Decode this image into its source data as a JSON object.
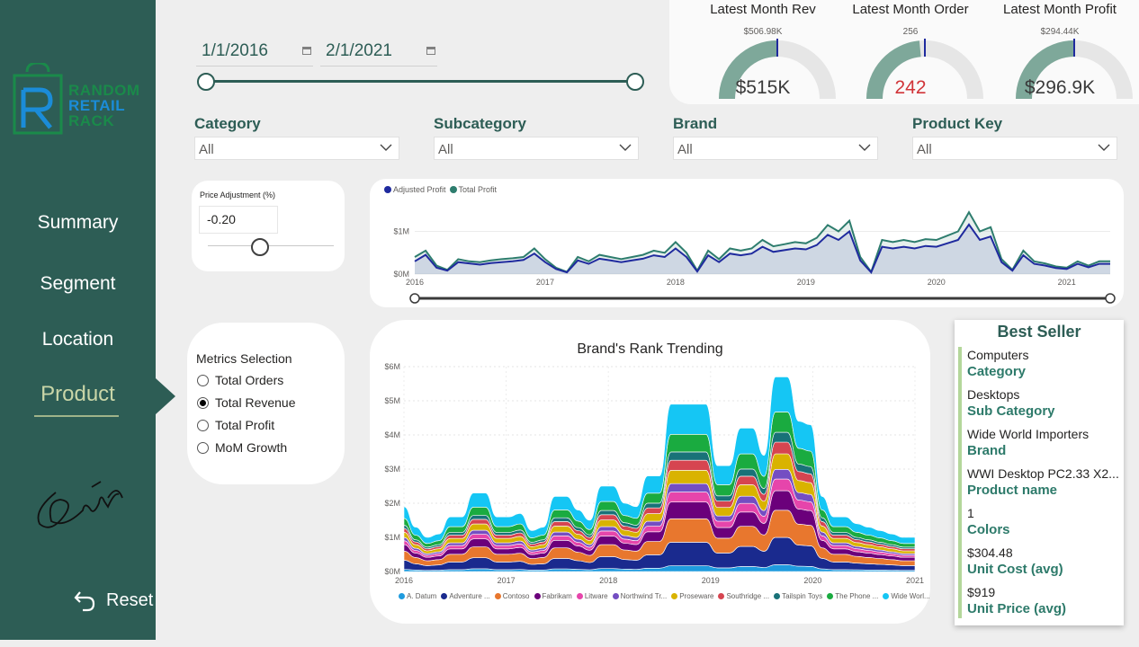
{
  "sidebar": {
    "logo": [
      "RANDOM",
      "RETAIL",
      "RACK"
    ],
    "nav": [
      {
        "label": "Summary"
      },
      {
        "label": "Segment"
      },
      {
        "label": "Location"
      },
      {
        "label": "Product"
      }
    ],
    "active": "Product",
    "reset_label": "Reset"
  },
  "date_range": {
    "start": "1/1/2016",
    "end": "2/1/2021"
  },
  "kpis": [
    {
      "title": "Latest Month Rev",
      "target": "$506.98K",
      "value": "$515K",
      "fill": 1.0,
      "value_color": "#3a3a3a"
    },
    {
      "title": "Latest Month Order",
      "target": "256",
      "value": "242",
      "fill": 0.47,
      "value_color": "#d13438"
    },
    {
      "title": "Latest Month Profit",
      "target": "$294.44K",
      "value": "$296.9K",
      "fill": 1.0,
      "value_color": "#3a3a3a"
    }
  ],
  "filters": [
    {
      "title": "Category",
      "value": "All"
    },
    {
      "title": "Subcategory",
      "value": "All"
    },
    {
      "title": "Brand",
      "value": "All"
    },
    {
      "title": "Product Key",
      "value": "All"
    }
  ],
  "price_adjustment": {
    "label": "Price Adjustment (%)",
    "value": "-0.20",
    "slider_fraction": 0.4
  },
  "metrics": {
    "title": "Metrics Selection",
    "options": [
      "Total Orders",
      "Total Revenue",
      "Total Profit",
      "MoM Growth"
    ],
    "selected": "Total Revenue"
  },
  "line_chart": {
    "legend": [
      {
        "name": "Adjusted Profit",
        "color": "#1f2a9e"
      },
      {
        "name": "Total Profit",
        "color": "#2e7d6e"
      }
    ],
    "y_ticks": [
      "$0M",
      "$1M"
    ],
    "x_ticks": [
      "2016",
      "2017",
      "2018",
      "2019",
      "2020",
      "2021"
    ]
  },
  "chart_data": [
    {
      "type": "area",
      "title": "",
      "ylim": [
        0,
        1.6
      ],
      "x_start": "2016-01",
      "x_end": "2021-02",
      "series": [
        {
          "name": "Total Profit",
          "color": "#2e7d6e",
          "values": [
            0.4,
            0.55,
            0.2,
            0.1,
            0.35,
            0.3,
            0.28,
            0.32,
            0.35,
            0.37,
            0.4,
            0.6,
            0.35,
            0.15,
            0.05,
            0.4,
            0.3,
            0.45,
            0.4,
            0.35,
            0.4,
            0.45,
            0.55,
            0.5,
            0.75,
            0.5,
            0.08,
            0.55,
            0.35,
            0.6,
            0.55,
            0.6,
            0.8,
            0.65,
            0.7,
            0.75,
            0.72,
            0.85,
            1.15,
            1.0,
            1.25,
            0.4,
            0.05,
            0.8,
            0.75,
            0.8,
            0.75,
            0.82,
            0.8,
            0.9,
            1.0,
            1.45,
            1.0,
            1.1,
            0.35,
            0.1,
            0.55,
            0.3,
            0.25,
            0.18,
            0.15,
            0.3,
            0.2,
            0.3,
            0.3
          ]
        },
        {
          "name": "Adjusted Profit",
          "color": "#1f2a9e",
          "values": [
            0.3,
            0.45,
            0.15,
            0.08,
            0.28,
            0.25,
            0.22,
            0.26,
            0.28,
            0.3,
            0.33,
            0.48,
            0.28,
            0.12,
            0.04,
            0.32,
            0.24,
            0.36,
            0.32,
            0.28,
            0.32,
            0.36,
            0.44,
            0.4,
            0.6,
            0.4,
            0.06,
            0.44,
            0.28,
            0.48,
            0.44,
            0.48,
            0.64,
            0.52,
            0.56,
            0.6,
            0.58,
            0.68,
            0.92,
            0.8,
            1.0,
            0.32,
            0.04,
            0.64,
            0.6,
            0.64,
            0.6,
            0.66,
            0.64,
            0.72,
            0.8,
            1.16,
            0.8,
            0.88,
            0.28,
            0.08,
            0.44,
            0.24,
            0.2,
            0.14,
            0.12,
            0.24,
            0.16,
            0.24,
            0.24
          ]
        }
      ]
    },
    {
      "type": "area",
      "title": "Brand's Rank Trending",
      "y_ticks": [
        "$0M",
        "$1M",
        "$2M",
        "$3M",
        "$4M",
        "$5M",
        "$6M"
      ],
      "x_ticks": [
        "2016",
        "2017",
        "2018",
        "2019",
        "2020",
        "2021"
      ],
      "ylim": [
        0,
        6
      ],
      "x_start": "2016-01",
      "x_end": "2021-01",
      "totals": [
        1.9,
        1.3,
        1.0,
        1.1,
        1.6,
        1.6,
        2.3,
        2.3,
        1.6,
        1.6,
        1.7,
        1.2,
        1.3,
        2.2,
        2.2,
        1.8,
        1.5,
        2.5,
        2.5,
        2.0,
        1.9,
        2.8,
        2.8,
        4.9,
        4.9,
        4.9,
        4.9,
        3.1,
        3.1,
        4.2,
        4.2,
        3.4,
        5.7,
        5.7,
        4.4,
        4.3,
        2.2,
        1.6,
        1.6,
        1.4,
        1.3,
        1.2,
        1.1,
        1.0,
        1.0
      ],
      "series": [
        {
          "name": "A. Datum",
          "color": "#1f9bde",
          "share": 0.035
        },
        {
          "name": "Adventure ...",
          "color": "#1a2a8e",
          "share": 0.14
        },
        {
          "name": "Contoso",
          "color": "#e8772e",
          "share": 0.14
        },
        {
          "name": "Fabrikam",
          "color": "#6b007b",
          "share": 0.1
        },
        {
          "name": "Litware",
          "color": "#e645ab",
          "share": 0.06
        },
        {
          "name": "Northwind Tr...",
          "color": "#744ec2",
          "share": 0.05
        },
        {
          "name": "Proseware",
          "color": "#d9b300",
          "share": 0.08
        },
        {
          "name": "Southridge ...",
          "color": "#d64550",
          "share": 0.06
        },
        {
          "name": "Tailspin Toys",
          "color": "#197278",
          "share": 0.05
        },
        {
          "name": "The Phone ...",
          "color": "#1aab40",
          "share": 0.105
        },
        {
          "name": "Wide Worl...",
          "color": "#15c6f4",
          "share": 0.18
        }
      ]
    }
  ],
  "best_seller": {
    "title": "Best Seller",
    "items": [
      {
        "value": "Computers",
        "label": "Category"
      },
      {
        "value": "Desktops",
        "label": "Sub Category"
      },
      {
        "value": "Wide World Importers",
        "label": "Brand"
      },
      {
        "value": "WWI Desktop PC2.33 X2...",
        "label": "Product name"
      },
      {
        "value": "1",
        "label": "Colors"
      },
      {
        "value": "$304.48",
        "label": "Unit Cost (avg)"
      },
      {
        "value": "$919",
        "label": "Unit Price (avg)"
      }
    ]
  }
}
